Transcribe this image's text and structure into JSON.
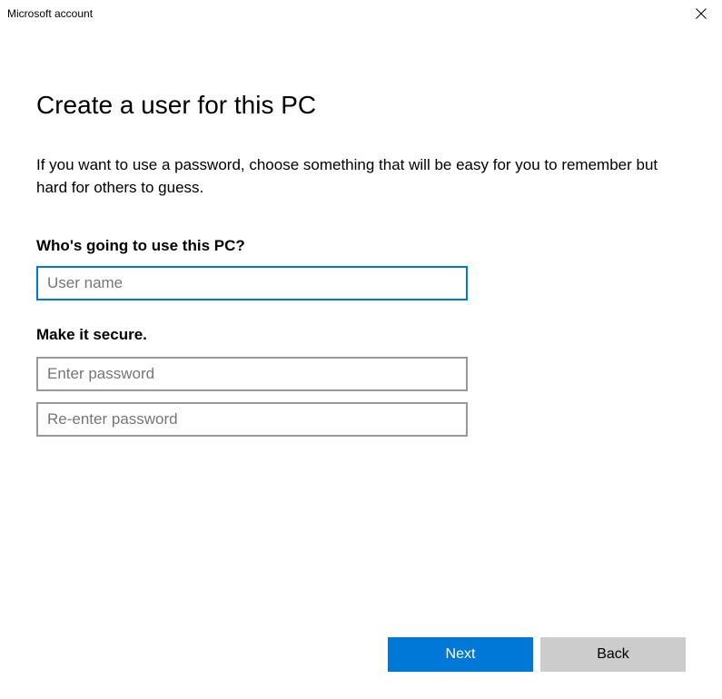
{
  "titlebar": {
    "title": "Microsoft account"
  },
  "main": {
    "heading": "Create a user for this PC",
    "description": "If you want to use a password, choose something that will be easy for you to remember but hard for others to guess.",
    "username_section_label": "Who's going to use this PC?",
    "username_placeholder": "User name",
    "username_value": "",
    "secure_section_label": "Make it secure.",
    "password_placeholder": "Enter password",
    "password_value": "",
    "confirm_password_placeholder": "Re-enter password",
    "confirm_password_value": ""
  },
  "footer": {
    "next_label": "Next",
    "back_label": "Back"
  }
}
